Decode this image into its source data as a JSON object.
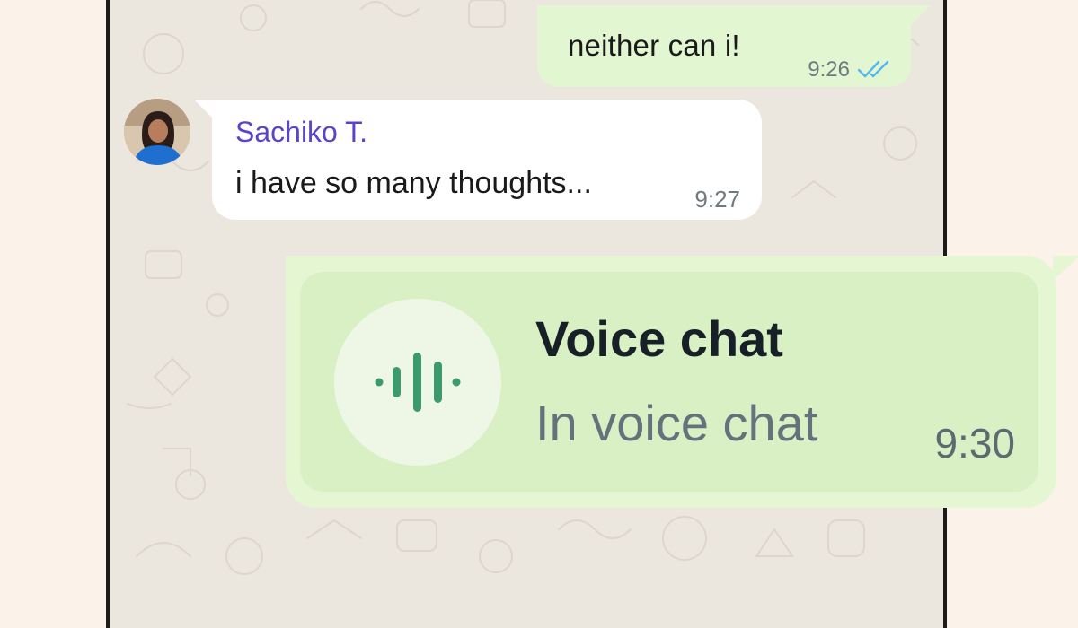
{
  "chat": {
    "outgoing": {
      "text": "neither can i!",
      "time": "9:26",
      "status_icon": "double-check-read-icon"
    },
    "incoming": {
      "sender": "Sachiko T.",
      "text": "i have so many thoughts...",
      "time": "9:27",
      "avatar_icon": "user-avatar"
    },
    "voice_chat": {
      "title": "Voice chat",
      "subtitle": "In voice chat",
      "time": "9:30",
      "icon": "soundwave-icon"
    }
  },
  "colors": {
    "outgoing_bubble": "#e3f6d2",
    "incoming_bubble": "#ffffff",
    "sender_name": "#5b43cc",
    "read_ticks": "#53b8f0",
    "voice_icon": "#3d9a6c",
    "chat_background": "#ebe6de"
  }
}
